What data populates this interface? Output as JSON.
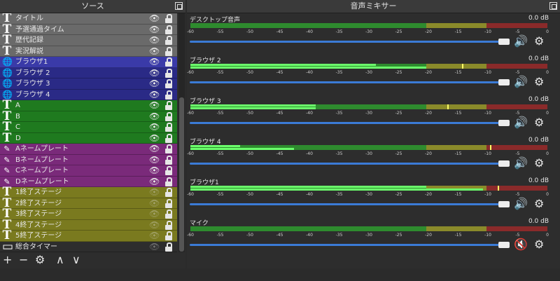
{
  "sources_panel": {
    "title": "ソース",
    "items": [
      {
        "label": "タイトル",
        "icon": "text-icon",
        "group_color": "#6a6a6a",
        "visible": true
      },
      {
        "label": "予選通過タイム",
        "icon": "text-icon",
        "group_color": "#6a6a6a",
        "visible": true
      },
      {
        "label": "歴代記録",
        "icon": "text-icon",
        "group_color": "#6a6a6a",
        "visible": true
      },
      {
        "label": "実況解説",
        "icon": "text-icon",
        "group_color": "#6a6a6a",
        "visible": true
      },
      {
        "label": "ブラウザ1",
        "icon": "globe-icon",
        "group_color": "#3a3aa8",
        "visible": true
      },
      {
        "label": "ブラウザ 2",
        "icon": "globe-icon",
        "group_color": "#2a2a86",
        "visible": true
      },
      {
        "label": "ブラウザ 3",
        "icon": "globe-icon",
        "group_color": "#2a2a86",
        "visible": true
      },
      {
        "label": "ブラウザ 4",
        "icon": "globe-icon",
        "group_color": "#2a2a86",
        "visible": true
      },
      {
        "label": "A",
        "icon": "text-icon",
        "group_color": "#1f7a1f",
        "visible": true
      },
      {
        "label": "B",
        "icon": "text-icon",
        "group_color": "#1f7a1f",
        "visible": true
      },
      {
        "label": "C",
        "icon": "text-icon",
        "group_color": "#1f7a1f",
        "visible": true
      },
      {
        "label": "D",
        "icon": "text-icon",
        "group_color": "#1f7a1f",
        "visible": true
      },
      {
        "label": "Aネームプレート",
        "icon": "brush-icon",
        "group_color": "#7a2a7a",
        "visible": true
      },
      {
        "label": "Bネームプレート",
        "icon": "brush-icon",
        "group_color": "#7a2a7a",
        "visible": true
      },
      {
        "label": "Cネームプレート",
        "icon": "brush-icon",
        "group_color": "#7a2a7a",
        "visible": true
      },
      {
        "label": "Dネームプレート",
        "icon": "brush-icon",
        "group_color": "#7a2a7a",
        "visible": true
      },
      {
        "label": "1終了ステージ",
        "icon": "text-icon",
        "group_color": "#7a7a1f",
        "visible": false
      },
      {
        "label": "2終了ステージ",
        "icon": "text-icon",
        "group_color": "#7a7a1f",
        "visible": false
      },
      {
        "label": "3終了ステージ",
        "icon": "text-icon",
        "group_color": "#7a7a1f",
        "visible": false
      },
      {
        "label": "4終了ステージ",
        "icon": "text-icon",
        "group_color": "#7a7a1f",
        "visible": false
      },
      {
        "label": "5終了ステージ",
        "icon": "text-icon",
        "group_color": "#7a7a1f",
        "visible": false
      },
      {
        "label": "総合タイマー",
        "icon": "monitor-icon",
        "group_color": "#2d2d2d",
        "visible": false
      }
    ],
    "toolbar": {
      "add": "+",
      "remove": "−",
      "settings_icon": "gear-icon",
      "up": "∧",
      "down": "∨"
    }
  },
  "mixer_panel": {
    "title": "音声ミキサー",
    "scale_ticks": [
      "-60",
      "-55",
      "-50",
      "-45",
      "-40",
      "-35",
      "-30",
      "-25",
      "-20",
      "-15",
      "-10",
      "-5",
      "0"
    ],
    "channels": [
      {
        "name": "デスクトップ音声",
        "db": "0.0 dB",
        "level_top": 0,
        "level_bottom": 0,
        "peak": null,
        "muted": false
      },
      {
        "name": "ブラウザ 2",
        "db": "0.0 dB",
        "level_top": 0.52,
        "level_bottom": 0.66,
        "peak": 0.76,
        "muted": false
      },
      {
        "name": "ブラウザ 3",
        "db": "0.0 dB",
        "level_top": 0.35,
        "level_bottom": 0.35,
        "peak": 0.72,
        "muted": false
      },
      {
        "name": "ブラウザ 4",
        "db": "0.0 dB",
        "level_top": 0.14,
        "level_bottom": 0.29,
        "peak": 0.84,
        "muted": false
      },
      {
        "name": "ブラウザ1",
        "db": "0.0 dB",
        "level_top": 0.66,
        "level_bottom": 0.82,
        "peak": 0.86,
        "muted": false
      },
      {
        "name": "マイク",
        "db": "0.0 dB",
        "level_top": 0,
        "level_bottom": 0,
        "peak": null,
        "muted": true
      }
    ]
  },
  "colors": {
    "green": "#2e8b2e",
    "yellow": "#8a8a2a",
    "red": "#8a2a2a",
    "fader": "#3b7bd6",
    "mute": "#e02020"
  }
}
